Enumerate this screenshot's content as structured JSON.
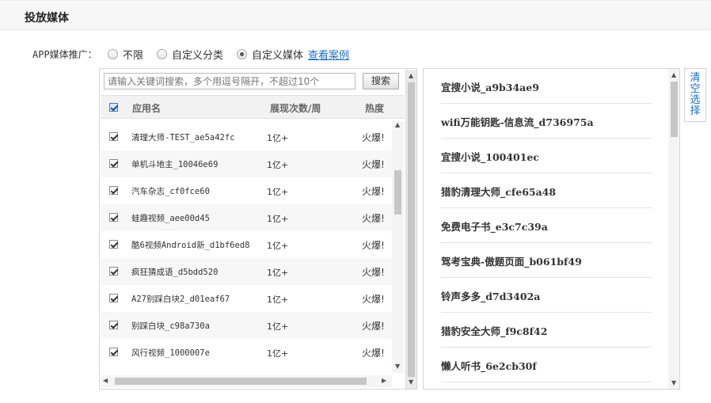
{
  "header": {
    "title": "投放媒体"
  },
  "promo": {
    "label": "APP媒体推广：",
    "options": [
      {
        "label": "不限",
        "checked": false
      },
      {
        "label": "自定义分类",
        "checked": false
      },
      {
        "label": "自定义媒体",
        "checked": true
      }
    ],
    "case_link": "查看案例"
  },
  "search": {
    "placeholder": "请输入关键词搜索，多个用逗号隔开，不超过10个",
    "button": "搜索"
  },
  "table": {
    "columns": [
      "应用名",
      "展现次数/周",
      "热度"
    ],
    "rows": [
      {
        "name": "清理大师-TEST_ae5a42fc",
        "views": "1亿+",
        "heat": "火爆!",
        "checked": true
      },
      {
        "name": "单机斗地主_10046e69",
        "views": "1亿+",
        "heat": "火爆!",
        "checked": true
      },
      {
        "name": "汽车杂志_cf0fce60",
        "views": "1亿+",
        "heat": "火爆!",
        "checked": true
      },
      {
        "name": "蛙趣视频_aee00d45",
        "views": "1亿+",
        "heat": "火爆!",
        "checked": true
      },
      {
        "name": "酷6视频Android新_d1bf6ed8",
        "views": "1亿+",
        "heat": "火爆!",
        "checked": true
      },
      {
        "name": "疯狂猜成语_d5bdd520",
        "views": "1亿+",
        "heat": "火爆!",
        "checked": true
      },
      {
        "name": "A27别踩白块2_d01eaf67",
        "views": "1亿+",
        "heat": "火爆!",
        "checked": true
      },
      {
        "name": "别踩白块_c98a730a",
        "views": "1亿+",
        "heat": "火爆!",
        "checked": true
      },
      {
        "name": "风行视频_1000007e",
        "views": "1亿+",
        "heat": "火爆!",
        "checked": true
      }
    ]
  },
  "selected": {
    "items": [
      "宜搜小说_a9b34ae9",
      "wifi万能钥匙-信息流_d736975a",
      "宜搜小说_100401ec",
      "猎豹清理大师_cfe65a48",
      "免费电子书_e3c7c39a",
      "驾考宝典-傲题页面_b061bf49",
      "铃声多多_d7d3402a",
      "猎豹安全大师_f9c8f42",
      "懒人听书_6e2cb30f"
    ],
    "clear_label": [
      "清",
      "空",
      "选",
      "择"
    ]
  }
}
